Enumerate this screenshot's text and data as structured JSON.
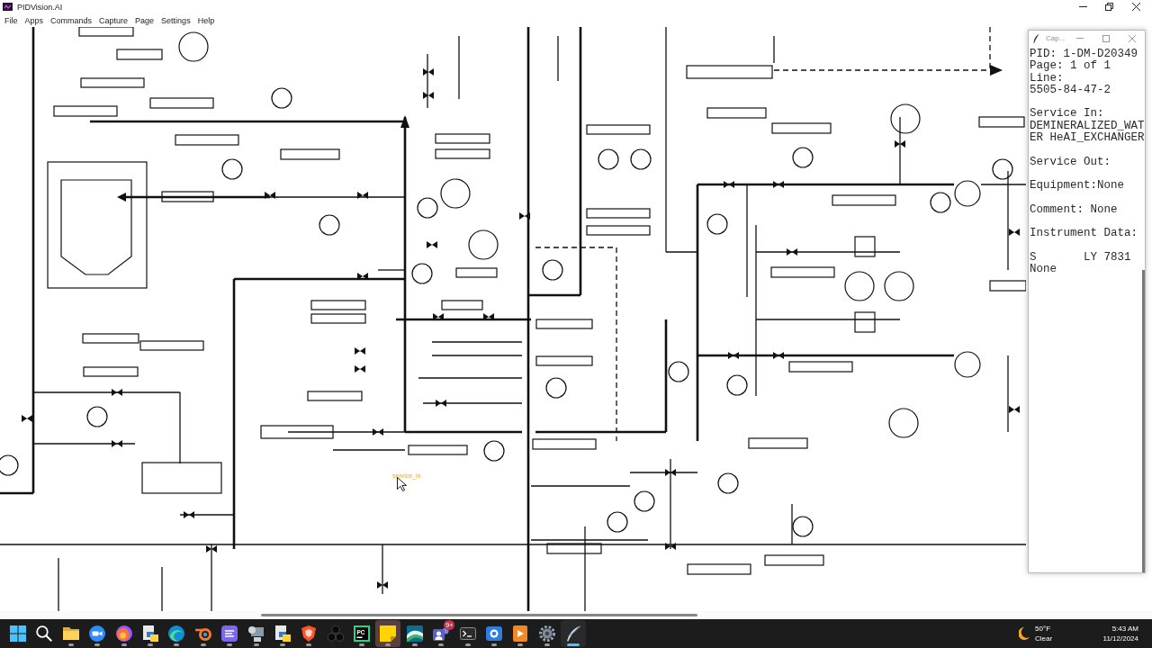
{
  "window": {
    "title": "PIDVision.AI"
  },
  "menu": [
    "File",
    "Apps",
    "Commands",
    "Capture",
    "Page",
    "Settings",
    "Help"
  ],
  "canvas": {
    "hover_label": "service_in"
  },
  "capture_window": {
    "title": "Cap...",
    "sections": [
      [
        "PID: 1-DM-D20349",
        "Page: 1 of 1",
        "Line:",
        "5505-84-47-2"
      ],
      [
        "Service In:",
        "DEMINERALIZED_WAT",
        "ER HeAI_EXCHANGER"
      ],
      [
        "Service Out:"
      ],
      [
        "Equipment:None"
      ],
      [
        "Comment: None"
      ],
      [
        "Instrument Data:"
      ],
      [
        "S       LY 7831",
        "None"
      ]
    ]
  },
  "taskbar": {
    "apps": [
      {
        "kind": "folder",
        "running": true,
        "selected": false,
        "hovered": false
      },
      {
        "kind": "video",
        "running": true,
        "selected": false,
        "hovered": false
      },
      {
        "kind": "fox",
        "running": true,
        "selected": false,
        "hovered": false
      },
      {
        "kind": "script",
        "running": true,
        "selected": false,
        "hovered": false
      },
      {
        "kind": "edge",
        "running": true,
        "selected": false,
        "hovered": false
      },
      {
        "kind": "orbit",
        "running": true,
        "selected": false,
        "hovered": false
      },
      {
        "kind": "notes",
        "running": true,
        "selected": false,
        "hovered": false
      },
      {
        "kind": "network",
        "running": true,
        "selected": false,
        "hovered": false
      },
      {
        "kind": "script",
        "running": true,
        "selected": false,
        "hovered": false
      },
      {
        "kind": "shield",
        "running": true,
        "selected": false,
        "hovered": false
      },
      {
        "kind": "trefoil",
        "running": false,
        "selected": false,
        "hovered": false
      },
      {
        "kind": "ide",
        "label": "PC",
        "running": true,
        "selected": false,
        "hovered": false
      },
      {
        "kind": "sticky",
        "running": true,
        "selected": false,
        "hovered": true
      },
      {
        "kind": "wave",
        "running": true,
        "selected": false,
        "hovered": false
      },
      {
        "kind": "team",
        "badge": "9+",
        "running": true,
        "selected": false,
        "hovered": false
      },
      {
        "kind": "terminal",
        "running": true,
        "selected": false,
        "hovered": false
      },
      {
        "kind": "record",
        "running": true,
        "selected": false,
        "hovered": false
      },
      {
        "kind": "media",
        "running": true,
        "selected": false,
        "hovered": false
      },
      {
        "kind": "gear",
        "running": true,
        "selected": false,
        "hovered": false
      },
      {
        "kind": "feather",
        "running": true,
        "selected": true,
        "hovered": false
      }
    ],
    "weather": {
      "temperature": "50°F",
      "condition": "Clear"
    },
    "clock": {
      "time": "5:43 AM",
      "date": "11/12/2024"
    }
  }
}
